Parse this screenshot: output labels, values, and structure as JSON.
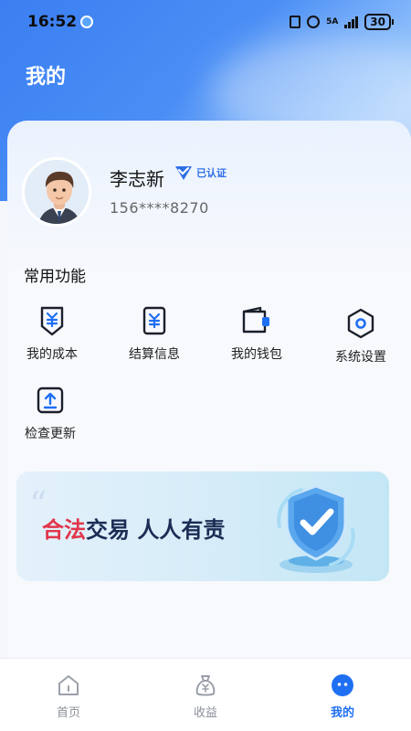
{
  "status_bar": {
    "time": "16:52",
    "network": "5A",
    "battery": "30"
  },
  "page": {
    "title": "我的"
  },
  "user": {
    "name": "李志新",
    "verified_label": "已认证",
    "phone": "156****8270"
  },
  "functions": {
    "section_title": "常用功能",
    "items": [
      {
        "label": "我的成本",
        "icon": "cost-icon"
      },
      {
        "label": "结算信息",
        "icon": "settlement-icon"
      },
      {
        "label": "我的钱包",
        "icon": "wallet-icon"
      },
      {
        "label": "系统设置",
        "icon": "settings-icon"
      },
      {
        "label": "检查更新",
        "icon": "update-icon"
      }
    ]
  },
  "banner": {
    "highlight": "合法",
    "text": "交易 人人有责"
  },
  "tabbar": {
    "items": [
      {
        "label": "首页",
        "icon": "home-icon",
        "active": false
      },
      {
        "label": "收益",
        "icon": "money-bag-icon",
        "active": false
      },
      {
        "label": "我的",
        "icon": "profile-icon",
        "active": true
      }
    ]
  },
  "colors": {
    "accent": "#1f6ff2",
    "banner_highlight": "#e2354a",
    "icon_dark": "#1a1f2b"
  }
}
